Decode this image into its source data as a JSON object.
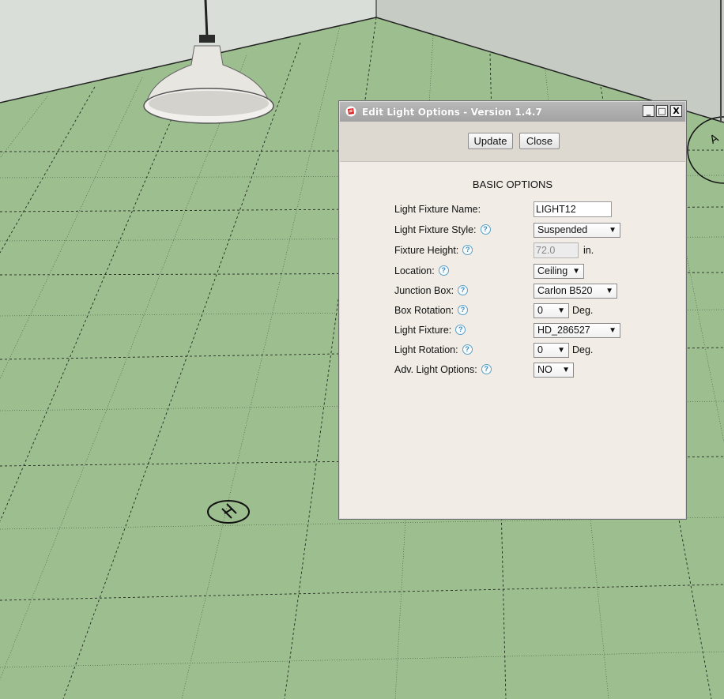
{
  "window": {
    "title": "Edit Light Options - Version 1.4.7",
    "min_symbol": "_",
    "max_symbol": "□",
    "close_symbol": "X"
  },
  "toolbar": {
    "update_label": "Update",
    "close_label": "Close"
  },
  "form": {
    "section_title": "BASIC OPTIONS",
    "help_glyph": "?",
    "fixture_name": {
      "label": "Light Fixture Name:",
      "value": "LIGHT12"
    },
    "fixture_style": {
      "label": "Light Fixture Style:",
      "value": "Suspended"
    },
    "fixture_height": {
      "label": "Fixture Height:",
      "value": "72.0",
      "unit": "in."
    },
    "location": {
      "label": "Location:",
      "value": "Ceiling"
    },
    "junction_box": {
      "label": "Junction Box:",
      "value": "Carlon B520"
    },
    "box_rotation": {
      "label": "Box Rotation:",
      "value": "0",
      "unit": "Deg."
    },
    "light_fixture": {
      "label": "Light Fixture:",
      "value": "HD_286527"
    },
    "light_rotation": {
      "label": "Light Rotation:",
      "value": "0",
      "unit": "Deg."
    },
    "adv_options": {
      "label": "Adv. Light Options:",
      "value": "NO"
    }
  }
}
